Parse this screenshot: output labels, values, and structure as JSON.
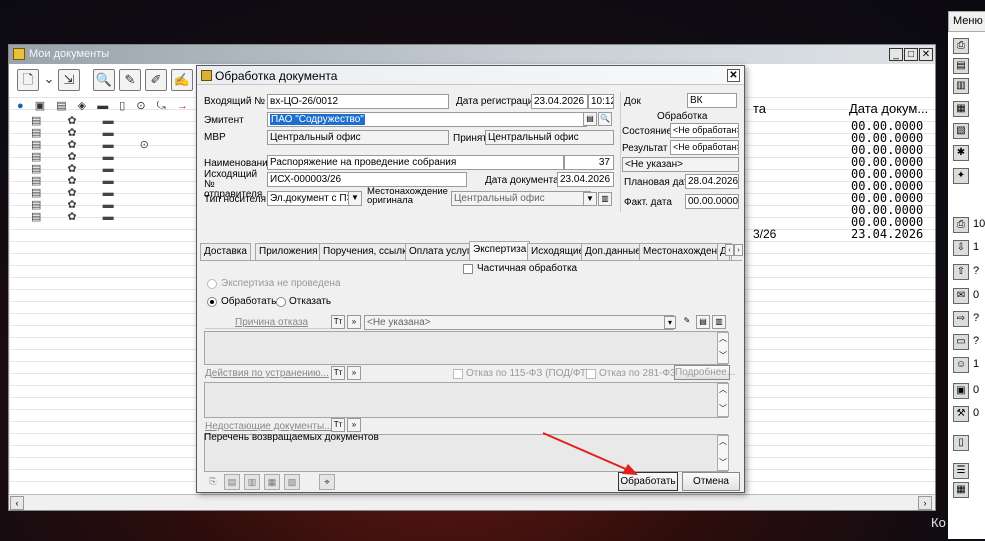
{
  "docs_window": {
    "title": "Мои документы",
    "col_header_partial": "та",
    "col_header_date": "Дата докум...",
    "dates": [
      "00.00.0000",
      "00.00.0000",
      "00.00.0000",
      "00.00.0000",
      "00.00.0000",
      "00.00.0000",
      "00.00.0000",
      "00.00.0000",
      "00.00.0000",
      "23.04.2026"
    ],
    "partial_cell": "3/26"
  },
  "right_panel": {
    "menu_label": "Меню",
    "counts": [
      "10",
      "1",
      "?",
      "0",
      "?",
      "?",
      "1",
      "0",
      "0"
    ],
    "ko_label": "Ко"
  },
  "dialog": {
    "title": "Обработка документа",
    "incoming_no_label": "Входящий №",
    "incoming_no": "вх-ЦО-26/0012",
    "reg_date_label": "Дата регистрации",
    "reg_date": "23.04.2026",
    "reg_time": "10:12",
    "doc_label": "Док",
    "doc_value": "ВК",
    "issuer_label": "Эмитент",
    "issuer": "ПАО \"Содружество\"",
    "processing_group": "Обработка",
    "state_label": "Состояние",
    "state": "<Не обработан>",
    "result_label": "Результат",
    "result": "<Не обработан>",
    "mvr_label": "МВР",
    "mvr": "Центральный офис",
    "accepted_label": "Принят",
    "accepted": "Центральный офис",
    "name_label": "Наименование",
    "name": "Распоряжение на проведение собрания",
    "name_count": "37",
    "unspecified": "<Не указан>",
    "out_no_label": "Исходящий № отправителя",
    "out_no": "ИСХ-000003/26",
    "doc_date_label": "Дата документа",
    "doc_date": "23.04.2026",
    "plan_date_label": "Плановая дата",
    "plan_date": "28.04.2026",
    "carrier_label": "Тип носителя",
    "carrier": "Эл.документ с ПЭП",
    "location_label": "Местонахождение оригинала",
    "location": "Центральный офис",
    "fact_date_label": "Факт. дата",
    "fact_date": "00.00.0000",
    "tabs": [
      "Доставка",
      "Приложения",
      "Поручения, ссылки",
      "Оплата услуг",
      "Экспертиза",
      "Исходящие",
      "Доп.данные",
      "Местонахождение",
      "Д"
    ],
    "partial_processing": "Частичная обработка",
    "expertise_not_done": "Экспертиза не проведена",
    "process_radio": "Обработать",
    "reject_radio": "Отказать",
    "reject_reason_label": "Причина отказа",
    "reject_reason_value": "<Не указана>",
    "actions_label": "Действия по устранению...",
    "refuse_115": "Отказ по 115-ФЗ (ПОД/ФТ)",
    "refuse_281": "Отказ по 281-ФЗ",
    "details_button": "Подробнее...",
    "missing_docs_label": "Недостающие документы...",
    "returned_docs_label": "Перечень возвращаемых документов",
    "process_button": "Обработать",
    "cancel_button": "Отмена"
  }
}
